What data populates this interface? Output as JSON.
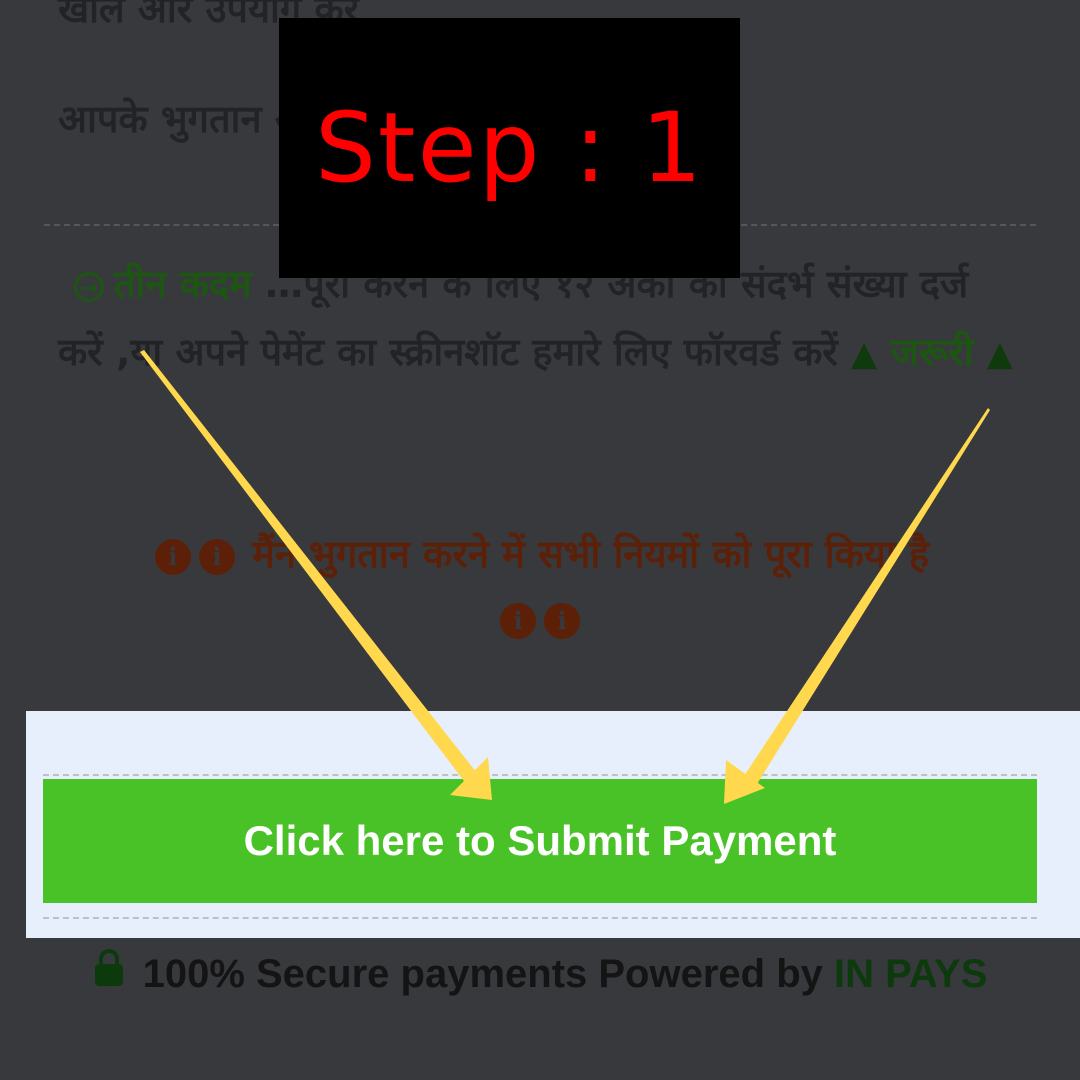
{
  "instructions": {
    "line_top": "खोलें और उपयोग करें",
    "line_ids": "आपके भुगतान                                   आईडी",
    "step_green": "तीन कदम",
    "step_rest": " …पूरा करने के लिए १२ अंकों की संदर्भ संख्या दर्ज करें ,या अपने पेमेंट का स्क्रीनशॉट हमारे लिए फॉरवर्ड करें",
    "warning_label": "जरूरी",
    "confirm_text": "मैंने भुगतान करने में सभी नियमों को पूरा किया है"
  },
  "overlay": {
    "label": "Step : 1"
  },
  "submit": {
    "label": "Click here to Submit Payment"
  },
  "footer": {
    "secure_text": "100% Secure payments Powered by",
    "brand": "IN PAYS"
  },
  "icons": {
    "step": "arrow-right-circle-icon",
    "warning": "warning-triangle-icon",
    "info": "info-circle-icon",
    "lock": "lock-icon"
  },
  "colors": {
    "background": "#38393d",
    "submit_button": "#49c228",
    "panel": "#e6effb",
    "overlay_text": "#ff0000",
    "arrows": "#ffd84d",
    "confirm_text": "#5b2007",
    "green_text": "#1d5512"
  }
}
